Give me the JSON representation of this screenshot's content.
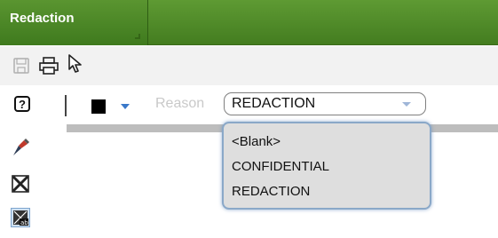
{
  "header": {
    "title": "Redaction"
  },
  "toolbar1": {
    "icons": [
      "save-icon",
      "print-icon",
      "pointer-icon"
    ]
  },
  "toolbar2": {
    "help_glyph": "?",
    "fill_color": "#000000",
    "reason_label": "Reason",
    "reason_value": "REDACTION"
  },
  "dropdown": {
    "options": [
      "<Blank>",
      "CONFIDENTIAL",
      "REDACTION"
    ]
  },
  "colors": {
    "header_green": "#4a8526",
    "dropdown_border": "#8aa8c8",
    "arrow_blue": "#3a78c9"
  },
  "left_tools": [
    "redaction-pen-icon",
    "redaction-box-icon",
    "redaction-text-icon"
  ]
}
